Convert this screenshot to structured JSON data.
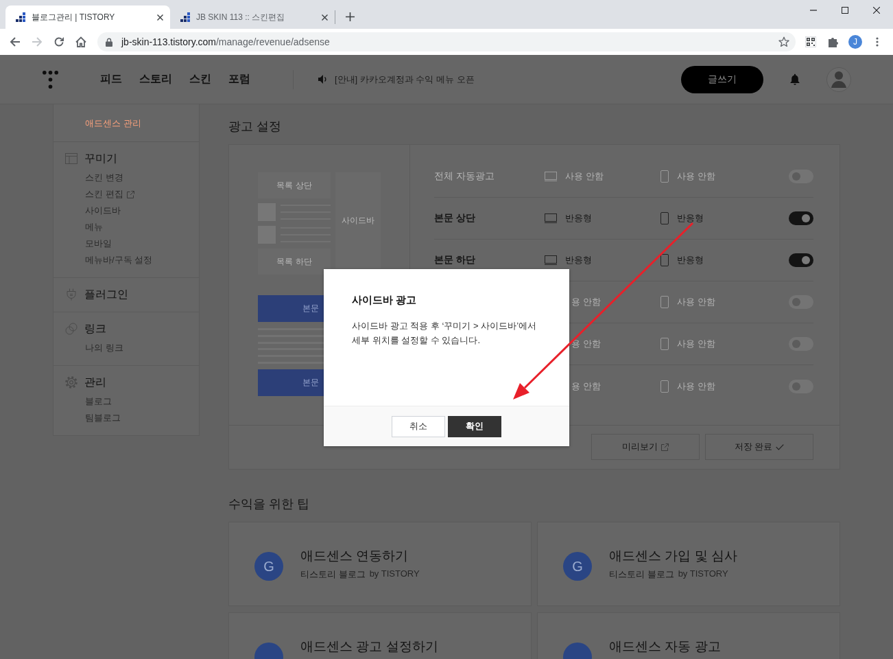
{
  "browser": {
    "tabs": [
      {
        "title": "블로그관리 | TISTORY",
        "selected": true
      },
      {
        "title": "JB SKIN 113 :: 스킨편집",
        "selected": false
      }
    ],
    "toolbar": [
      {
        "kind": "back",
        "disabled": false
      },
      {
        "kind": "forward",
        "disabled": true
      },
      {
        "kind": "reload",
        "disabled": false
      },
      {
        "kind": "home",
        "disabled": false
      }
    ],
    "address": {
      "host": "jb-skin-113.tistory.com",
      "path": "/manage/revenue/adsense"
    },
    "profile": "J"
  },
  "header": {
    "nav": [
      "피드",
      "스토리",
      "스킨",
      "포럼"
    ],
    "notice": "[안내] 카카오계정과 수익 메뉴 오픈",
    "write_button": "글쓰기"
  },
  "sidebar": {
    "sections": [
      {
        "items": [
          {
            "label": "애드센스 관리",
            "selected": true,
            "external": false
          }
        ]
      },
      {
        "kind": "decorate",
        "title": "꾸미기",
        "items": [
          {
            "label": "스킨 변경",
            "selected": false,
            "external": false
          },
          {
            "label": "스킨 편집",
            "selected": false,
            "external": true
          },
          {
            "label": "사이드바",
            "selected": false,
            "external": false
          },
          {
            "label": "메뉴",
            "selected": false,
            "external": false
          },
          {
            "label": "모바일",
            "selected": false,
            "external": false
          },
          {
            "label": "메뉴바/구독 설정",
            "selected": false,
            "external": false
          }
        ]
      },
      {
        "kind": "plugin",
        "title": "플러그인"
      },
      {
        "kind": "link",
        "title": "링크",
        "items": [
          {
            "label": "나의 링크",
            "selected": false,
            "external": false
          }
        ]
      },
      {
        "kind": "manage",
        "title": "관리",
        "items": [
          {
            "label": "블로그",
            "selected": false,
            "external": false
          },
          {
            "label": "팀블로그",
            "selected": false,
            "external": false
          }
        ]
      }
    ]
  },
  "main": {
    "ad_settings": {
      "title": "광고 설정",
      "preview": {
        "list_top": "목록 상단",
        "sidebar": "사이드바",
        "list_bottom": "목록 하단",
        "body_top": "본문",
        "body_bottom": "본문"
      },
      "rows": [
        {
          "label": "전체 자동광고",
          "pc": "사용 안함",
          "mobile": "사용 안함",
          "on": false
        },
        {
          "label": "본문 상단",
          "pc": "반응형",
          "mobile": "반응형",
          "on": true
        },
        {
          "label": "본문 하단",
          "pc": "반응형",
          "mobile": "반응형",
          "on": true
        },
        {
          "pc": "용 안함",
          "mobile": "사용 안함",
          "on": false
        },
        {
          "pc": "용 안함",
          "mobile": "사용 안함",
          "on": false
        },
        {
          "pc": "용 안함",
          "mobile": "사용 안함",
          "on": false
        }
      ],
      "buttons": [
        {
          "kind": "preview",
          "label": "미리보기"
        },
        {
          "kind": "save",
          "label": "저장 완료"
        }
      ]
    },
    "tips": {
      "title": "수익을 위한 팁",
      "cards": [
        {
          "letter": "G",
          "title": "애드센스 연동하기",
          "source": "티스토리 블로그",
          "author": "by TISTORY"
        },
        {
          "letter": "G",
          "title": "애드센스 가입 및 심사",
          "source": "티스토리 블로그",
          "author": "by TISTORY"
        },
        {
          "title": "애드센스 광고 설정하기"
        },
        {
          "title": "애드센스 자동 광고"
        }
      ]
    }
  },
  "dialog": {
    "title": "사이드바 광고",
    "message": "사이드바 광고 적용 후 ‘꾸미기 > 사이드바’에서 세부 위치를 설정할 수 있습니다.",
    "buttons": [
      {
        "kind": "cancel",
        "label": "취소"
      },
      {
        "kind": "confirm",
        "label": "확인"
      }
    ]
  }
}
